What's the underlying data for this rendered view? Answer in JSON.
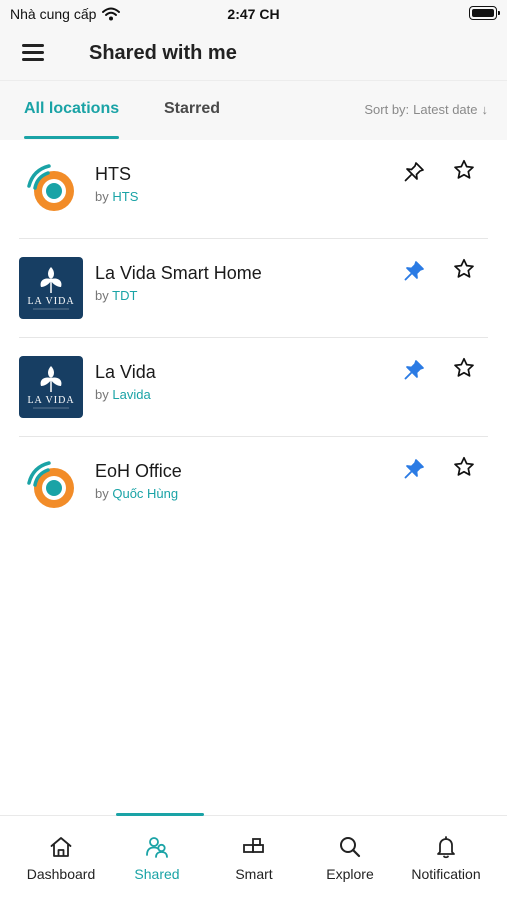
{
  "status_bar": {
    "carrier": "Nhà cung cấp",
    "time": "2:47 CH"
  },
  "header": {
    "title": "Shared with me"
  },
  "tabs": [
    {
      "label": "All locations",
      "active": true
    },
    {
      "label": "Starred",
      "active": false
    }
  ],
  "sort": {
    "label": "Sort by:",
    "value": "Latest date",
    "arrow": "↓"
  },
  "locations": [
    {
      "name": "HTS",
      "by_prefix": "by",
      "owner": "HTS",
      "logo": "eoh-logo",
      "pinned": false,
      "starred": false
    },
    {
      "name": "La Vida Smart Home",
      "by_prefix": "by",
      "owner": "TDT",
      "logo": "lavida-logo",
      "pinned": true,
      "starred": false
    },
    {
      "name": "La Vida",
      "by_prefix": "by",
      "owner": "Lavida",
      "logo": "lavida-logo",
      "pinned": true,
      "starred": false
    },
    {
      "name": "EoH Office",
      "by_prefix": "by",
      "owner": "Quốc Hùng",
      "logo": "eoh-logo",
      "pinned": true,
      "starred": false
    }
  ],
  "lavida_logo_text": "LA VIDA",
  "bottom_nav": [
    {
      "label": "Dashboard",
      "icon": "home-icon",
      "active": false
    },
    {
      "label": "Shared",
      "icon": "shared-users-icon",
      "active": true
    },
    {
      "label": "Smart",
      "icon": "blocks-icon",
      "active": false
    },
    {
      "label": "Explore",
      "icon": "search-icon",
      "active": false
    },
    {
      "label": "Notification",
      "icon": "bell-icon",
      "active": false
    }
  ],
  "colors": {
    "accent": "#1aa3a6",
    "pin_active": "#2b7be4",
    "orange": "#f28c28",
    "lavida_bg": "#173e63"
  }
}
